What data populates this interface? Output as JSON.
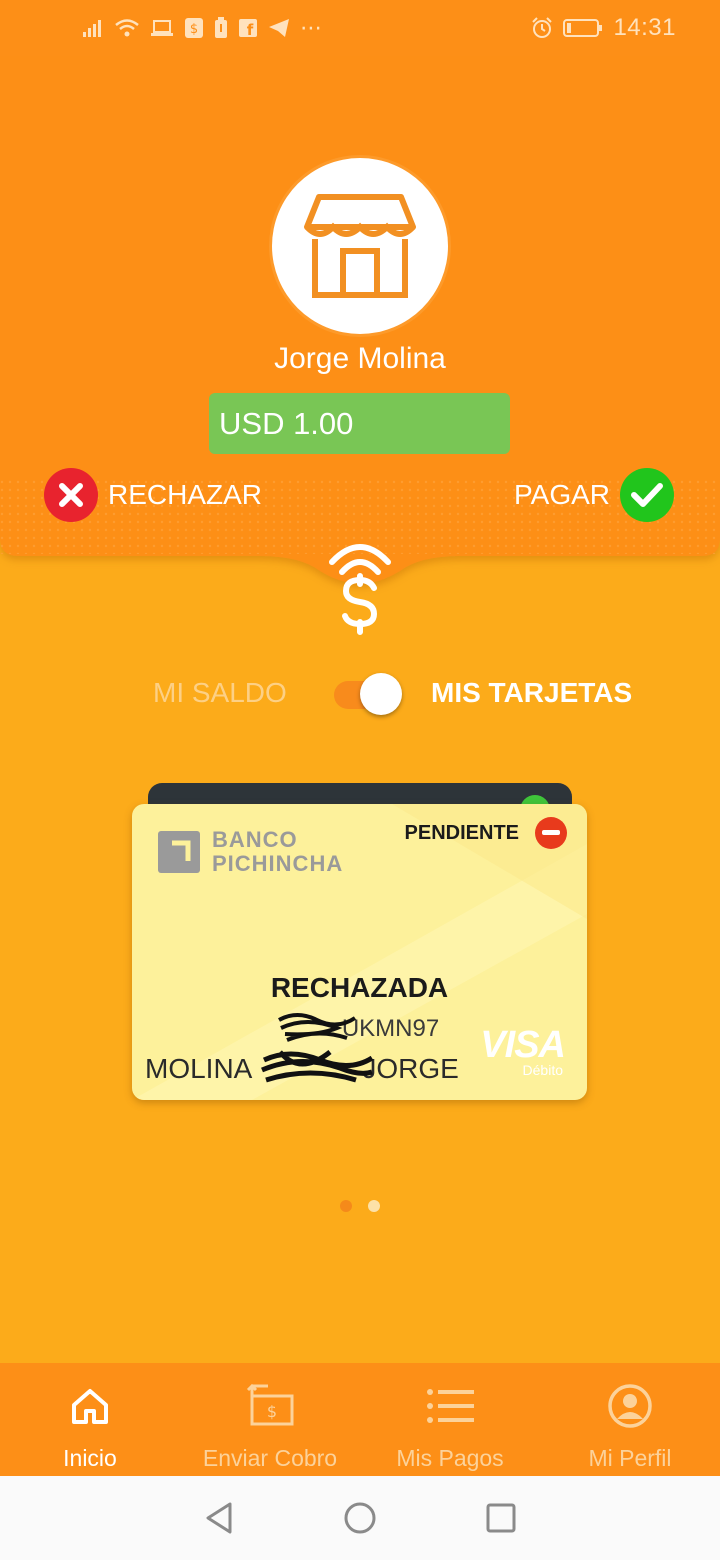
{
  "status_bar": {
    "time": "14:31",
    "left_icons": [
      "signal-icon",
      "wifi-icon",
      "laptop-icon",
      "dollar-app-icon",
      "battery-saver-icon",
      "facebook-icon",
      "telegram-icon",
      "more-icon"
    ],
    "right_icons": [
      "alarm-icon",
      "battery-icon"
    ]
  },
  "payment_request": {
    "merchant_icon": "store-icon",
    "merchant_name": "Jorge Molina",
    "amount": "USD 1.00",
    "reject_label": "RECHAZAR",
    "pay_label": "PAGAR",
    "signal_icon": "contactless-dollar-icon"
  },
  "balance_toggle": {
    "left_label": "MI SALDO",
    "right_label": "MIS TARJETAS",
    "selected": "MIS TARJETAS"
  },
  "card": {
    "bank_name_line1": "BANCO",
    "bank_name_line2": "PICHINCHA",
    "status": "PENDIENTE",
    "state": "RECHAZADA",
    "number_visible": "UKMN97",
    "holder_first": "MOLINA",
    "holder_last": "JORGE",
    "network": "VISA",
    "network_sub": "Débito"
  },
  "carousel": {
    "pages": 2,
    "current": 1
  },
  "bottom_nav": {
    "items": [
      {
        "label": "Inicio",
        "icon": "home-icon",
        "active": true
      },
      {
        "label": "Enviar Cobro",
        "icon": "send-charge-icon",
        "active": false
      },
      {
        "label": "Mis Pagos",
        "icon": "list-icon",
        "active": false
      },
      {
        "label": "Mi Perfil",
        "icon": "profile-icon",
        "active": false
      }
    ]
  },
  "colors": {
    "background": "#fcab1a",
    "header": "#fd8f17",
    "amount_bg": "#79c655",
    "reject": "#e8232e",
    "pay": "#21c51c",
    "card": "#fdf19b"
  }
}
